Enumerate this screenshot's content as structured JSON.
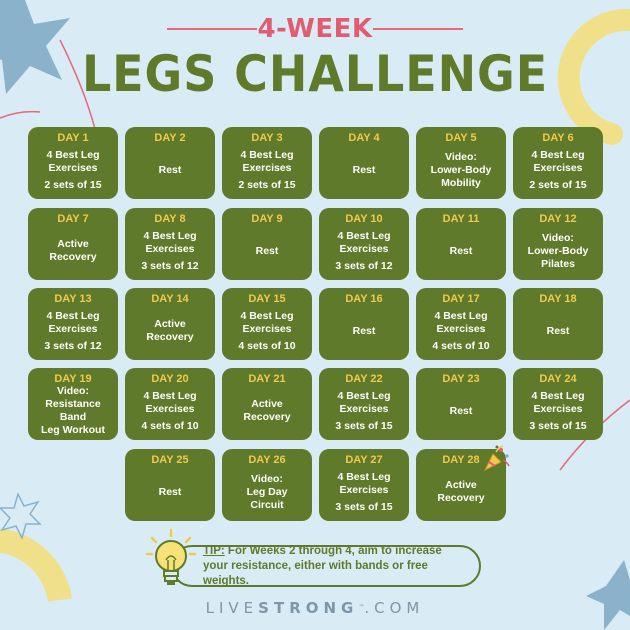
{
  "header": {
    "subtitle": "4-WEEK",
    "title": "LEGS CHALLENGE"
  },
  "days": [
    {
      "day": "DAY 1",
      "text": "4 Best Leg\nExercises",
      "sets": "2 sets of 15"
    },
    {
      "day": "DAY 2",
      "text": "Rest",
      "sets": ""
    },
    {
      "day": "DAY 3",
      "text": "4 Best Leg\nExercises",
      "sets": "2 sets of 15"
    },
    {
      "day": "DAY 4",
      "text": "Rest",
      "sets": ""
    },
    {
      "day": "DAY 5",
      "text": "Video:\nLower-Body\nMobility",
      "sets": ""
    },
    {
      "day": "DAY 6",
      "text": "4 Best Leg\nExercises",
      "sets": "2 sets of 15"
    },
    {
      "day": "DAY 7",
      "text": "Active\nRecovery",
      "sets": ""
    },
    {
      "day": "DAY 8",
      "text": "4 Best Leg\nExercises",
      "sets": "3 sets of 12"
    },
    {
      "day": "DAY 9",
      "text": "Rest",
      "sets": ""
    },
    {
      "day": "DAY 10",
      "text": "4 Best Leg\nExercises",
      "sets": "3 sets of 12"
    },
    {
      "day": "DAY 11",
      "text": "Rest",
      "sets": ""
    },
    {
      "day": "DAY 12",
      "text": "Video:\nLower-Body\nPilates",
      "sets": ""
    },
    {
      "day": "DAY 13",
      "text": "4 Best Leg\nExercises",
      "sets": "3 sets of 12"
    },
    {
      "day": "DAY 14",
      "text": "Active\nRecovery",
      "sets": ""
    },
    {
      "day": "DAY 15",
      "text": "4 Best Leg\nExercises",
      "sets": "4 sets of 10"
    },
    {
      "day": "DAY 16",
      "text": "Rest",
      "sets": ""
    },
    {
      "day": "DAY 17",
      "text": "4 Best Leg\nExercises",
      "sets": "4 sets of 10"
    },
    {
      "day": "DAY 18",
      "text": "Rest",
      "sets": ""
    },
    {
      "day": "DAY 19",
      "text": "Video:\nResistance Band\nLeg Workout",
      "sets": ""
    },
    {
      "day": "DAY 20",
      "text": "4 Best Leg\nExercises",
      "sets": "4 sets of 10"
    },
    {
      "day": "DAY 21",
      "text": "Active\nRecovery",
      "sets": ""
    },
    {
      "day": "DAY 22",
      "text": "4 Best Leg\nExercises",
      "sets": "3 sets of 15"
    },
    {
      "day": "DAY 23",
      "text": "Rest",
      "sets": ""
    },
    {
      "day": "DAY 24",
      "text": "4 Best Leg\nExercises",
      "sets": "3 sets of 15"
    },
    {
      "day": "DAY 25",
      "text": "Rest",
      "sets": ""
    },
    {
      "day": "DAY 26",
      "text": "Video:\nLeg Day\nCircuit",
      "sets": ""
    },
    {
      "day": "DAY 27",
      "text": "4 Best Leg\nExercises",
      "sets": "3 sets of 15"
    },
    {
      "day": "DAY 28",
      "text": "Active\nRecovery",
      "sets": ""
    }
  ],
  "tip": {
    "label": "TIP:",
    "text": " For Weeks 2 through 4, aim to increase your resistance, either with bands or free weights."
  },
  "logo": {
    "light_part": "LIVE",
    "bold_part": "STRONG",
    "tm": "™",
    "suffix": ".COM"
  },
  "icons": {
    "decoration_1": "starburst-icon",
    "decoration_2": "party-popper-icon",
    "decoration_3": "lightbulb-icon"
  },
  "colors": {
    "background": "#d9ecf6",
    "cell": "#5f7a2a",
    "day_label": "#f2c94c",
    "subtitle": "#e25b6e",
    "title": "#5f7a2a",
    "accent_yellow": "#f0e08a",
    "accent_blue": "#8ab2cb"
  }
}
